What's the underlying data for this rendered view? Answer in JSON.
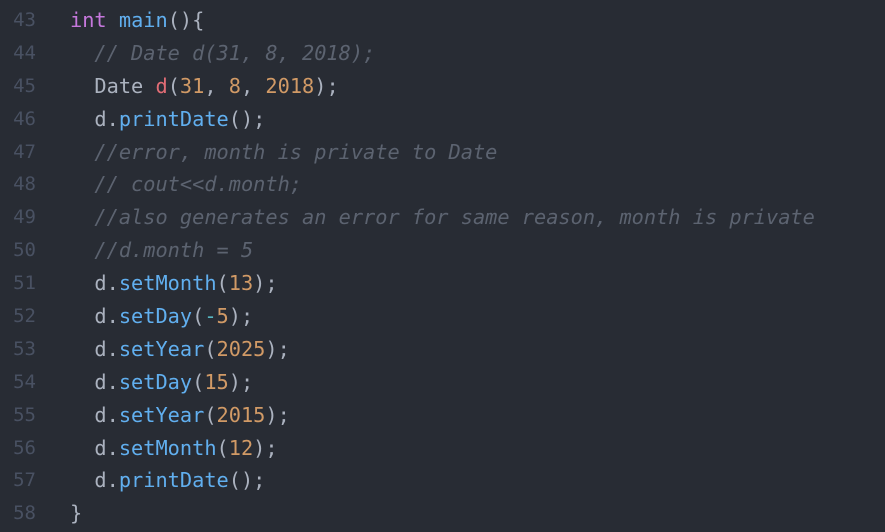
{
  "editor": {
    "lines": [
      {
        "num": "43",
        "tokens": [
          {
            "t": "int",
            "k": "kw"
          },
          {
            "t": " ",
            "k": "pl"
          },
          {
            "t": "main",
            "k": "fn"
          },
          {
            "t": "(){",
            "k": "pl"
          }
        ]
      },
      {
        "num": "44",
        "tokens": [
          {
            "t": "  ",
            "k": "pl"
          },
          {
            "t": "// Date d(31, 8, 2018);",
            "k": "cm"
          }
        ]
      },
      {
        "num": "45",
        "tokens": [
          {
            "t": "  Date ",
            "k": "pl"
          },
          {
            "t": "d",
            "k": "id"
          },
          {
            "t": "(",
            "k": "pl"
          },
          {
            "t": "31",
            "k": "num"
          },
          {
            "t": ", ",
            "k": "pl"
          },
          {
            "t": "8",
            "k": "num"
          },
          {
            "t": ", ",
            "k": "pl"
          },
          {
            "t": "2018",
            "k": "num"
          },
          {
            "t": ");",
            "k": "pl"
          }
        ]
      },
      {
        "num": "46",
        "tokens": [
          {
            "t": "  d.",
            "k": "pl"
          },
          {
            "t": "printDate",
            "k": "fn"
          },
          {
            "t": "();",
            "k": "pl"
          }
        ]
      },
      {
        "num": "47",
        "tokens": [
          {
            "t": "  ",
            "k": "pl"
          },
          {
            "t": "//error, month is private to Date",
            "k": "cm"
          }
        ]
      },
      {
        "num": "48",
        "tokens": [
          {
            "t": "  ",
            "k": "pl"
          },
          {
            "t": "// cout<<d.month;",
            "k": "cm"
          }
        ]
      },
      {
        "num": "49",
        "tokens": [
          {
            "t": "  ",
            "k": "pl"
          },
          {
            "t": "//also generates an error for same reason, month is private",
            "k": "cm"
          }
        ]
      },
      {
        "num": "50",
        "tokens": [
          {
            "t": "  ",
            "k": "pl"
          },
          {
            "t": "//d.month = 5",
            "k": "cm"
          }
        ]
      },
      {
        "num": "51",
        "tokens": [
          {
            "t": "  d.",
            "k": "pl"
          },
          {
            "t": "setMonth",
            "k": "fn"
          },
          {
            "t": "(",
            "k": "pl"
          },
          {
            "t": "13",
            "k": "num"
          },
          {
            "t": ");",
            "k": "pl"
          }
        ]
      },
      {
        "num": "52",
        "tokens": [
          {
            "t": "  d.",
            "k": "pl"
          },
          {
            "t": "setDay",
            "k": "fn"
          },
          {
            "t": "(",
            "k": "pl"
          },
          {
            "t": "-",
            "k": "op"
          },
          {
            "t": "5",
            "k": "num"
          },
          {
            "t": ");",
            "k": "pl"
          }
        ]
      },
      {
        "num": "53",
        "tokens": [
          {
            "t": "  d.",
            "k": "pl"
          },
          {
            "t": "setYear",
            "k": "fn"
          },
          {
            "t": "(",
            "k": "pl"
          },
          {
            "t": "2025",
            "k": "num"
          },
          {
            "t": ");",
            "k": "pl"
          }
        ]
      },
      {
        "num": "54",
        "tokens": [
          {
            "t": "  d.",
            "k": "pl"
          },
          {
            "t": "setDay",
            "k": "fn"
          },
          {
            "t": "(",
            "k": "pl"
          },
          {
            "t": "15",
            "k": "num"
          },
          {
            "t": ");",
            "k": "pl"
          }
        ]
      },
      {
        "num": "55",
        "tokens": [
          {
            "t": "  d.",
            "k": "pl"
          },
          {
            "t": "setYear",
            "k": "fn"
          },
          {
            "t": "(",
            "k": "pl"
          },
          {
            "t": "2015",
            "k": "num"
          },
          {
            "t": ");",
            "k": "pl"
          }
        ]
      },
      {
        "num": "56",
        "tokens": [
          {
            "t": "  d.",
            "k": "pl"
          },
          {
            "t": "setMonth",
            "k": "fn"
          },
          {
            "t": "(",
            "k": "pl"
          },
          {
            "t": "12",
            "k": "num"
          },
          {
            "t": ");",
            "k": "pl"
          }
        ]
      },
      {
        "num": "57",
        "tokens": [
          {
            "t": "  d.",
            "k": "pl"
          },
          {
            "t": "printDate",
            "k": "fn"
          },
          {
            "t": "();",
            "k": "pl"
          }
        ]
      },
      {
        "num": "58",
        "tokens": [
          {
            "t": "}",
            "k": "pl"
          }
        ]
      }
    ]
  },
  "colors": {
    "background": "#282c34",
    "gutter": "#495162",
    "keyword": "#c678dd",
    "function": "#61afef",
    "number": "#d19a66",
    "identifier": "#e06c75",
    "comment": "#5c6370",
    "operator": "#56b6c2",
    "plain": "#abb2bf"
  }
}
